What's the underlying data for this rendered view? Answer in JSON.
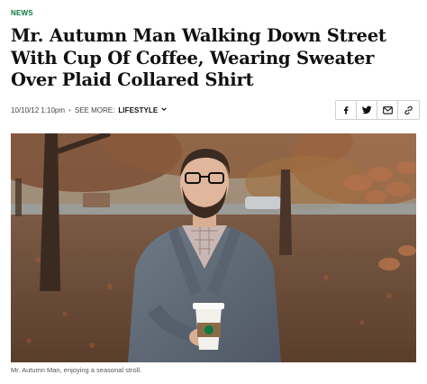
{
  "article": {
    "section_label": "NEWS",
    "headline": "Mr. Autumn Man Walking Down Street With Cup Of Coffee, Wearing Sweater Over Plaid Collared Shirt",
    "date": "10/10/12 1:10pm",
    "see_more_label": "SEE MORE:",
    "section_link": "LIFESTYLE",
    "image_caption": "Mr. Autumn Man, enjoying a seasonal stroll."
  },
  "share": {
    "buttons": [
      {
        "icon": "facebook-icon"
      },
      {
        "icon": "twitter-icon"
      },
      {
        "icon": "email-icon"
      },
      {
        "icon": "link-icon"
      }
    ]
  },
  "colors": {
    "accent_green": "#0a7a3f",
    "headline": "#111111",
    "meta": "#444444"
  }
}
